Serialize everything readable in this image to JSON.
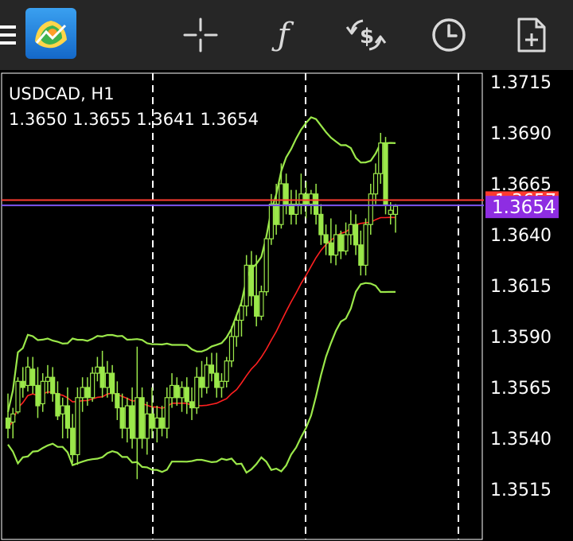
{
  "symbol": "USDCAD, H1",
  "ohlc": "1.3650 1.3655 1.3641 1.3654",
  "current_price": "1.3654",
  "hidden_line_price": "1.3657",
  "colors": {
    "background": "#000000",
    "toolbar": "#262626",
    "candle": "#9be84a",
    "bands": "#9be84a",
    "ma": "#ff2020",
    "bid_line": "#ff3b30",
    "ask_line": "#7b55f0",
    "price_tag": "#8e2de2",
    "grid": "#ffffff"
  },
  "toolbar": {
    "icons": [
      "menu-icon",
      "app-logo-icon",
      "crosshair-icon",
      "indicators-icon",
      "trade-icon",
      "history-icon",
      "new-order-icon"
    ]
  },
  "chart_data": {
    "type": "candlestick",
    "title": "USDCAD, H1",
    "ylim": [
      1.35,
      1.372
    ],
    "y_ticks": [
      "1.3715",
      "1.3690",
      "1.3665",
      "1.3640",
      "1.3615",
      "1.3590",
      "1.3565",
      "1.3540",
      "1.3515"
    ],
    "candles": [
      [
        1.355,
        1.3562,
        1.354,
        1.3545
      ],
      [
        1.3548,
        1.3555,
        1.354,
        1.3552
      ],
      [
        1.3553,
        1.357,
        1.3552,
        1.3568
      ],
      [
        1.3568,
        1.3575,
        1.356,
        1.3565
      ],
      [
        1.3566,
        1.358,
        1.3563,
        1.3575
      ],
      [
        1.3574,
        1.358,
        1.3562,
        1.3566
      ],
      [
        1.3566,
        1.3575,
        1.355,
        1.3556
      ],
      [
        1.3557,
        1.3572,
        1.3553,
        1.3568
      ],
      [
        1.3568,
        1.3576,
        1.3562,
        1.357
      ],
      [
        1.357,
        1.3575,
        1.3558,
        1.3562
      ],
      [
        1.3562,
        1.3568,
        1.3549,
        1.3551
      ],
      [
        1.3552,
        1.356,
        1.354,
        1.3556
      ],
      [
        1.3556,
        1.3565,
        1.354,
        1.3545
      ],
      [
        1.3545,
        1.3552,
        1.3528,
        1.3532
      ],
      [
        1.3532,
        1.3565,
        1.3527,
        1.356
      ],
      [
        1.356,
        1.357,
        1.3553,
        1.3565
      ],
      [
        1.3565,
        1.357,
        1.3556,
        1.356
      ],
      [
        1.356,
        1.3575,
        1.3558,
        1.3572
      ],
      [
        1.3572,
        1.358,
        1.3568,
        1.3575
      ],
      [
        1.3575,
        1.3583,
        1.356,
        1.3565
      ],
      [
        1.3565,
        1.3578,
        1.356,
        1.3572
      ],
      [
        1.3572,
        1.3576,
        1.3558,
        1.3562
      ],
      [
        1.3562,
        1.3568,
        1.3549,
        1.3555
      ],
      [
        1.3555,
        1.3562,
        1.354,
        1.3545
      ],
      [
        1.3545,
        1.356,
        1.3538,
        1.3556
      ],
      [
        1.3556,
        1.3565,
        1.3535,
        1.354
      ],
      [
        1.354,
        1.3585,
        1.352,
        1.356
      ],
      [
        1.356,
        1.3565,
        1.3535,
        1.354
      ],
      [
        1.354,
        1.3558,
        1.3532,
        1.3552
      ],
      [
        1.3552,
        1.3565,
        1.354,
        1.3545
      ],
      [
        1.3545,
        1.3556,
        1.3538,
        1.355
      ],
      [
        1.355,
        1.3556,
        1.3541,
        1.3545
      ],
      [
        1.3545,
        1.3565,
        1.354,
        1.356
      ],
      [
        1.356,
        1.3572,
        1.3555,
        1.3566
      ],
      [
        1.3566,
        1.357,
        1.3556,
        1.356
      ],
      [
        1.356,
        1.3568,
        1.3553,
        1.3565
      ],
      [
        1.3565,
        1.357,
        1.3552,
        1.3558
      ],
      [
        1.3558,
        1.3565,
        1.3549,
        1.3555
      ],
      [
        1.3555,
        1.3575,
        1.3552,
        1.357
      ],
      [
        1.357,
        1.3578,
        1.356,
        1.3565
      ],
      [
        1.3565,
        1.358,
        1.3562,
        1.3576
      ],
      [
        1.3576,
        1.3582,
        1.3568,
        1.3572
      ],
      [
        1.3572,
        1.3582,
        1.356,
        1.3565
      ],
      [
        1.3565,
        1.3572,
        1.356,
        1.3568
      ],
      [
        1.3568,
        1.358,
        1.3565,
        1.3578
      ],
      [
        1.3578,
        1.3595,
        1.3575,
        1.359
      ],
      [
        1.359,
        1.36,
        1.3585,
        1.3598
      ],
      [
        1.3598,
        1.3608,
        1.359,
        1.3605
      ],
      [
        1.3605,
        1.363,
        1.36,
        1.3625
      ],
      [
        1.3625,
        1.3632,
        1.3605,
        1.361
      ],
      [
        1.361,
        1.363,
        1.3595,
        1.36
      ],
      [
        1.36,
        1.3615,
        1.3598,
        1.3612
      ],
      [
        1.3612,
        1.364,
        1.361,
        1.3638
      ],
      [
        1.3638,
        1.366,
        1.3635,
        1.3655
      ],
      [
        1.3655,
        1.3665,
        1.364,
        1.3645
      ],
      [
        1.3645,
        1.3675,
        1.3643,
        1.3665
      ],
      [
        1.3665,
        1.367,
        1.365,
        1.3655
      ],
      [
        1.3655,
        1.3662,
        1.3645,
        1.365
      ],
      [
        1.365,
        1.3662,
        1.3645,
        1.3655
      ],
      [
        1.3655,
        1.367,
        1.365,
        1.366
      ],
      [
        1.366,
        1.3666,
        1.3648,
        1.3655
      ],
      [
        1.3655,
        1.3662,
        1.365,
        1.366
      ],
      [
        1.366,
        1.3665,
        1.3645,
        1.365
      ],
      [
        1.365,
        1.3655,
        1.3635,
        1.364
      ],
      [
        1.364,
        1.3645,
        1.363,
        1.3636
      ],
      [
        1.3636,
        1.3648,
        1.3626,
        1.363
      ],
      [
        1.363,
        1.3645,
        1.3625,
        1.364
      ],
      [
        1.364,
        1.3642,
        1.3628,
        1.3632
      ],
      [
        1.3632,
        1.3646,
        1.363,
        1.364
      ],
      [
        1.364,
        1.3652,
        1.3635,
        1.3645
      ],
      [
        1.3645,
        1.365,
        1.363,
        1.3635
      ],
      [
        1.3635,
        1.3642,
        1.362,
        1.3625
      ],
      [
        1.3625,
        1.3648,
        1.362,
        1.3645
      ],
      [
        1.3645,
        1.3665,
        1.364,
        1.366
      ],
      [
        1.366,
        1.3675,
        1.3655,
        1.367
      ],
      [
        1.367,
        1.369,
        1.3665,
        1.3685
      ],
      [
        1.3685,
        1.3688,
        1.365,
        1.3655
      ],
      [
        1.365,
        1.3656,
        1.3645,
        1.3652
      ],
      [
        1.365,
        1.3655,
        1.3641,
        1.3654
      ]
    ]
  }
}
